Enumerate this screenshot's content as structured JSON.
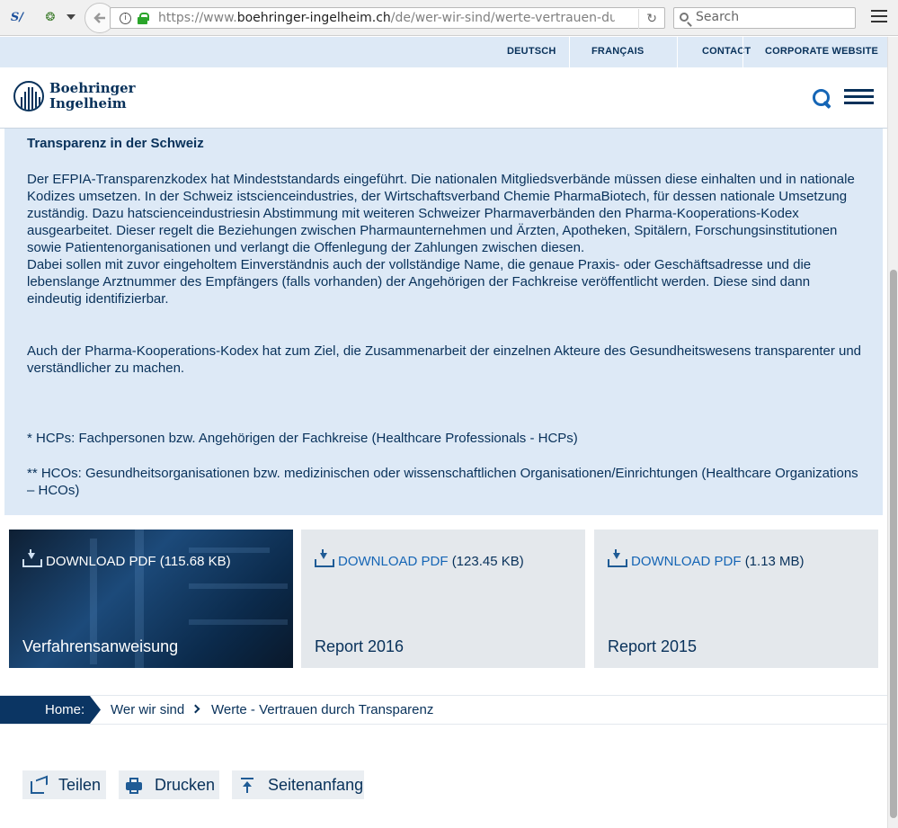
{
  "browser": {
    "url_prefix": "https://www.",
    "url_domain": "boehringer-ingelheim.ch",
    "url_path": "/de/wer-wir-sind/werte-vertrauen-durch-tra",
    "search_placeholder": "Search"
  },
  "topnav": {
    "items": [
      "DEUTSCH",
      "FRANÇAIS",
      "CONTACT",
      "CORPORATE WEBSITE"
    ]
  },
  "logo": {
    "line1": "Boehringer",
    "line2": "Ingelheim"
  },
  "infobox": {
    "heading": "Transparenz in der Schweiz",
    "para1": "Der EFPIA-Transparenzkodex hat Mindeststandards eingeführt. Die nationalen Mitgliedsverbände müssen diese einhalten und in nationale Kodizes umsetzen. In der Schweiz istscienceindustries, der Wirtschaftsverband Chemie PharmaBiotech, für dessen nationale Umsetzung zuständig. Dazu hatscienceindustriesin Abstimmung mit weiteren Schweizer Pharmaverbänden den Pharma-Kooperations-Kodex ausgearbeitet. Dieser regelt die Beziehungen zwischen Pharmaunternehmen und Ärzten, Apotheken, Spitälern, Forschungsinstitutionen sowie Patientenorganisationen und verlangt die Offenlegung der Zahlungen zwischen diesen.",
    "para2": "Dabei sollen mit zuvor eingeholtem Einverständnis auch der vollständige Name, die genaue Praxis- oder Geschäftsadresse und die lebenslange Arztnummer des Empfängers (falls vorhanden) der Angehörigen der Fachkreise veröffentlicht werden. Diese sind dann eindeutig identifizierbar.",
    "para3": "Auch der Pharma-Kooperations-Kodex hat zum Ziel, die Zusammenarbeit der einzelnen Akteure des Gesundheitswesens transparenter und verständlicher zu machen.",
    "note1": "* HCPs: Fachpersonen bzw. Angehörigen der Fachkreise (Healthcare Professionals - HCPs)",
    "note2": "** HCOs: Gesundheitsorganisationen bzw. medizinischen oder wissenschaftlichen Organisationen/Einrichtungen (Healthcare Organizations – HCOs)"
  },
  "downloads": [
    {
      "link": "DOWNLOAD PDF",
      "size": "(115.68 KB)",
      "title": "Verfahrensanweisung"
    },
    {
      "link": "DOWNLOAD PDF",
      "size": "(123.45 KB)",
      "title": "Report 2016"
    },
    {
      "link": "DOWNLOAD PDF",
      "size": "(1.13 MB)",
      "title": "Report 2015"
    }
  ],
  "breadcrumb": {
    "home": "Home:",
    "items": [
      "Wer wir sind",
      "Werte - Vertrauen durch Transparenz"
    ]
  },
  "actions": {
    "share": "Teilen",
    "print": "Drucken",
    "top": "Seitenanfang"
  },
  "colors": {
    "navy": "#08315a",
    "link_blue": "#1565b5",
    "light_blue_bg": "#dde9f6"
  }
}
